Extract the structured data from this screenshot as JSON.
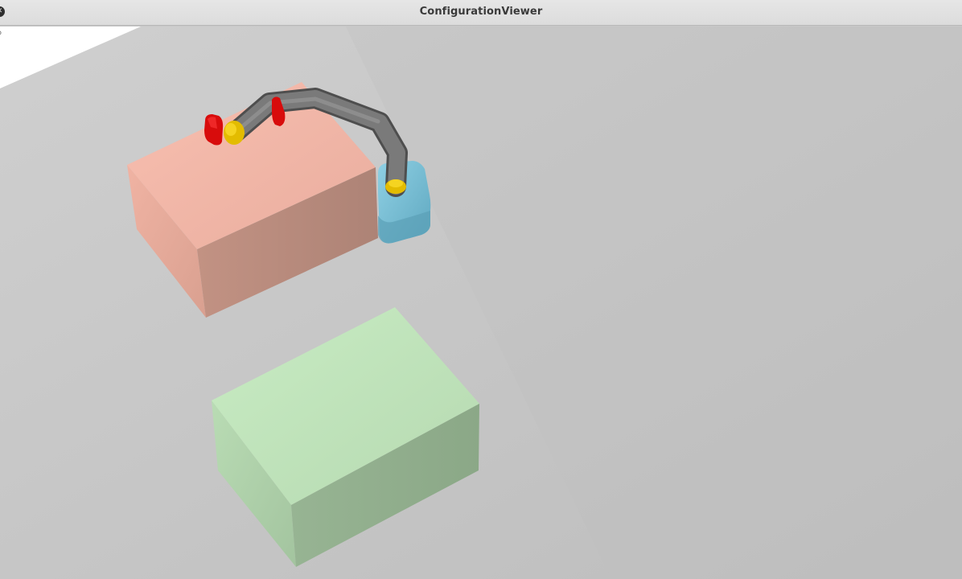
{
  "window": {
    "title": "ConfigurationViewer",
    "close_glyph": "✕"
  },
  "viewport": {
    "corner_mark": "o",
    "scene": {
      "background_color": "#c4c4c4",
      "sky_color": "#ffffff",
      "objects": [
        {
          "name": "salmon-box",
          "color": "#f3b4a4"
        },
        {
          "name": "green-box",
          "color": "#bfe3bb"
        },
        {
          "name": "blue-base-block",
          "color": "#78c0d8"
        },
        {
          "name": "gray-robot-arm",
          "color": "#6e6e6e"
        },
        {
          "name": "yellow-joint",
          "color": "#e8c300"
        },
        {
          "name": "red-gripper",
          "color": "#e01010"
        }
      ]
    }
  }
}
